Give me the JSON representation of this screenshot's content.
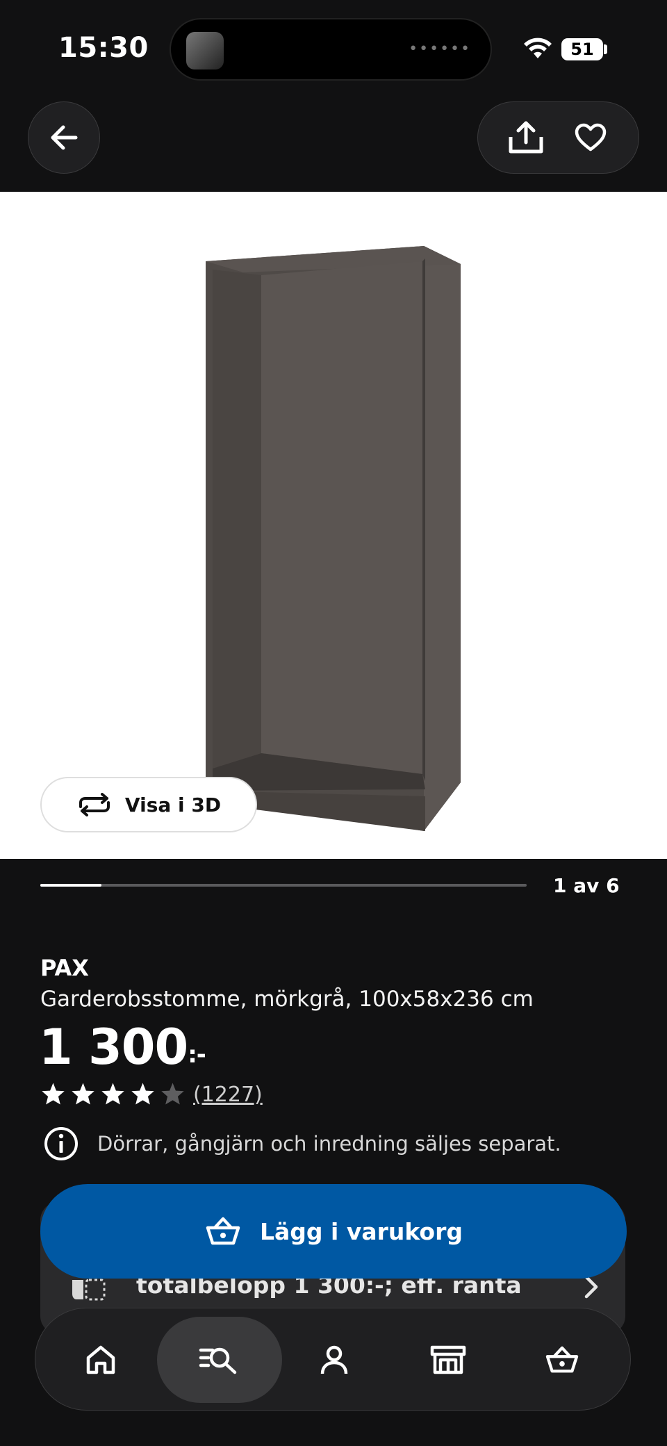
{
  "status_bar": {
    "time": "15:30",
    "battery": "51"
  },
  "product": {
    "brand": "PAX",
    "description": "Garderobsstomme, mörkgrå, 100x58x236 cm",
    "price": "1 300",
    "price_suffix": ":-",
    "rating": 4,
    "rating_max": 5,
    "reviews": "(1227)",
    "notice": "Dörrar, gångjärn och inredning säljes separat."
  },
  "gallery": {
    "view_3d_label": "Visa i 3D",
    "counter": "1 av 6",
    "progress": 0.125
  },
  "cart_button": {
    "label": "Lägg i varukorg"
  },
  "finance": {
    "text": "totalbelopp 1 300:-; eff. ränta"
  },
  "colors": {
    "accent": "#0058a3",
    "background": "#111112",
    "card": "#2a2a2c"
  },
  "tabs": [
    {
      "name": "home",
      "icon": "home-icon"
    },
    {
      "name": "search",
      "icon": "search-list-icon",
      "active": true
    },
    {
      "name": "profile",
      "icon": "person-icon"
    },
    {
      "name": "store",
      "icon": "store-icon"
    },
    {
      "name": "cart",
      "icon": "basket-icon"
    }
  ]
}
